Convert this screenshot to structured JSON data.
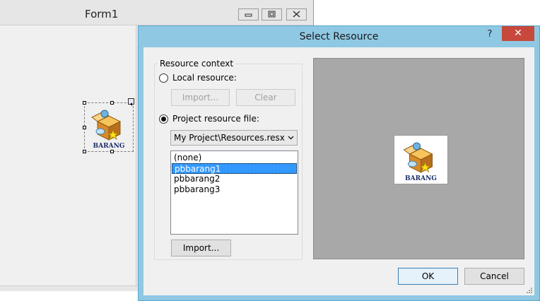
{
  "form1": {
    "title": "Form1",
    "picture_box_caption": "BARANG"
  },
  "dialog": {
    "title": "Select Resource",
    "help_glyph": "?",
    "close_glyph": "✕",
    "resource_context": {
      "legend": "Resource context",
      "local_resource_label": "Local resource:",
      "local_selected": false,
      "import_label": "Import...",
      "clear_label": "Clear",
      "project_resource_label": "Project resource file:",
      "project_selected": true,
      "resource_file": "My Project\\Resources.resx",
      "resources": [
        "(none)",
        "pbbarang1",
        "pbbarang2",
        "pbbarang3"
      ],
      "selected_resource": "pbbarang1",
      "project_import_label": "Import..."
    },
    "preview": {
      "caption": "BARANG"
    },
    "ok_label": "OK",
    "cancel_label": "Cancel"
  },
  "colors": {
    "dialog_frame": "#8fc8e3",
    "close_button": "#c7493c",
    "selection": "#3399ff",
    "preview_background": "#a8a8a8"
  }
}
